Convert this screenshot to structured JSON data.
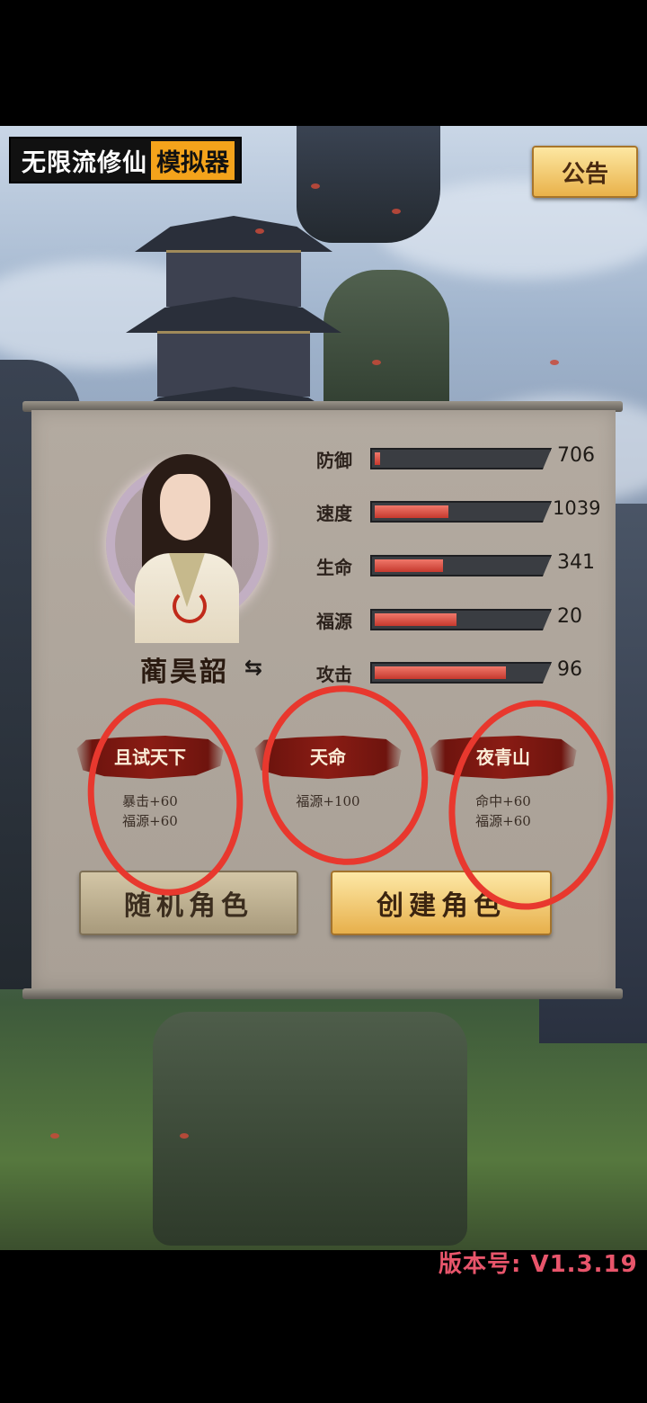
{
  "header": {
    "title_main": "无限流修仙",
    "title_highlight": "模拟器",
    "notice_label": "公告"
  },
  "character": {
    "name": "蔺昊韶",
    "swap_icon": "swap-icon"
  },
  "stats": [
    {
      "label": "防御",
      "value": "706",
      "fill": 0.03
    },
    {
      "label": "速度",
      "value": "1039",
      "fill": 0.43
    },
    {
      "label": "生命",
      "value": "341",
      "fill": 0.4
    },
    {
      "label": "福源",
      "value": "20",
      "fill": 0.48
    },
    {
      "label": "攻击",
      "value": "96",
      "fill": 0.77
    }
  ],
  "traits": [
    {
      "name": "且试天下",
      "effects": [
        "暴击+60",
        "福源+60"
      ]
    },
    {
      "name": "天命",
      "effects": [
        "福源+100"
      ]
    },
    {
      "name": "夜青山",
      "effects": [
        "命中+60",
        "福源+60"
      ]
    }
  ],
  "buttons": {
    "random": "随机角色",
    "create": "创建角色"
  },
  "version": "版本号: V1.3.19",
  "colors": {
    "accent": "#f4a31b",
    "bar_fill": "#e0554a",
    "annotation": "#e8382e"
  }
}
